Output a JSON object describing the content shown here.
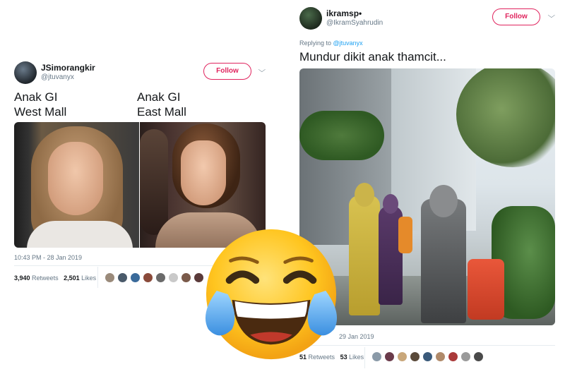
{
  "tweet1": {
    "name": "JSimorangkir",
    "handle": "@jtuvanyx",
    "follow_label": "Follow",
    "text_left": "Anak GI\nWest Mall",
    "text_right": "Anak GI\nEast Mall",
    "timestamp": "10:43 PM - 28 Jan 2019",
    "retweets": "3,940",
    "retweets_label": "Retweets",
    "likes": "2,501",
    "likes_label": "Likes"
  },
  "tweet2": {
    "name": "ikramsp•",
    "handle": "@IkramSyahrudin",
    "follow_label": "Follow",
    "replying_prefix": "Replying to ",
    "replying_to": "@jtuvanyx",
    "text": "Mundur dikit anak thamcit...",
    "timestamp": "29 Jan 2019",
    "retweets": "51",
    "retweets_label": "Retweets",
    "likes": "53",
    "likes_label": "Likes"
  },
  "colors": {
    "accent": "#e0245e",
    "link": "#1da1f2",
    "muted": "#657786"
  },
  "icons": {
    "more": "chevron-down-icon",
    "emoji": "face-with-tears-of-joy"
  }
}
